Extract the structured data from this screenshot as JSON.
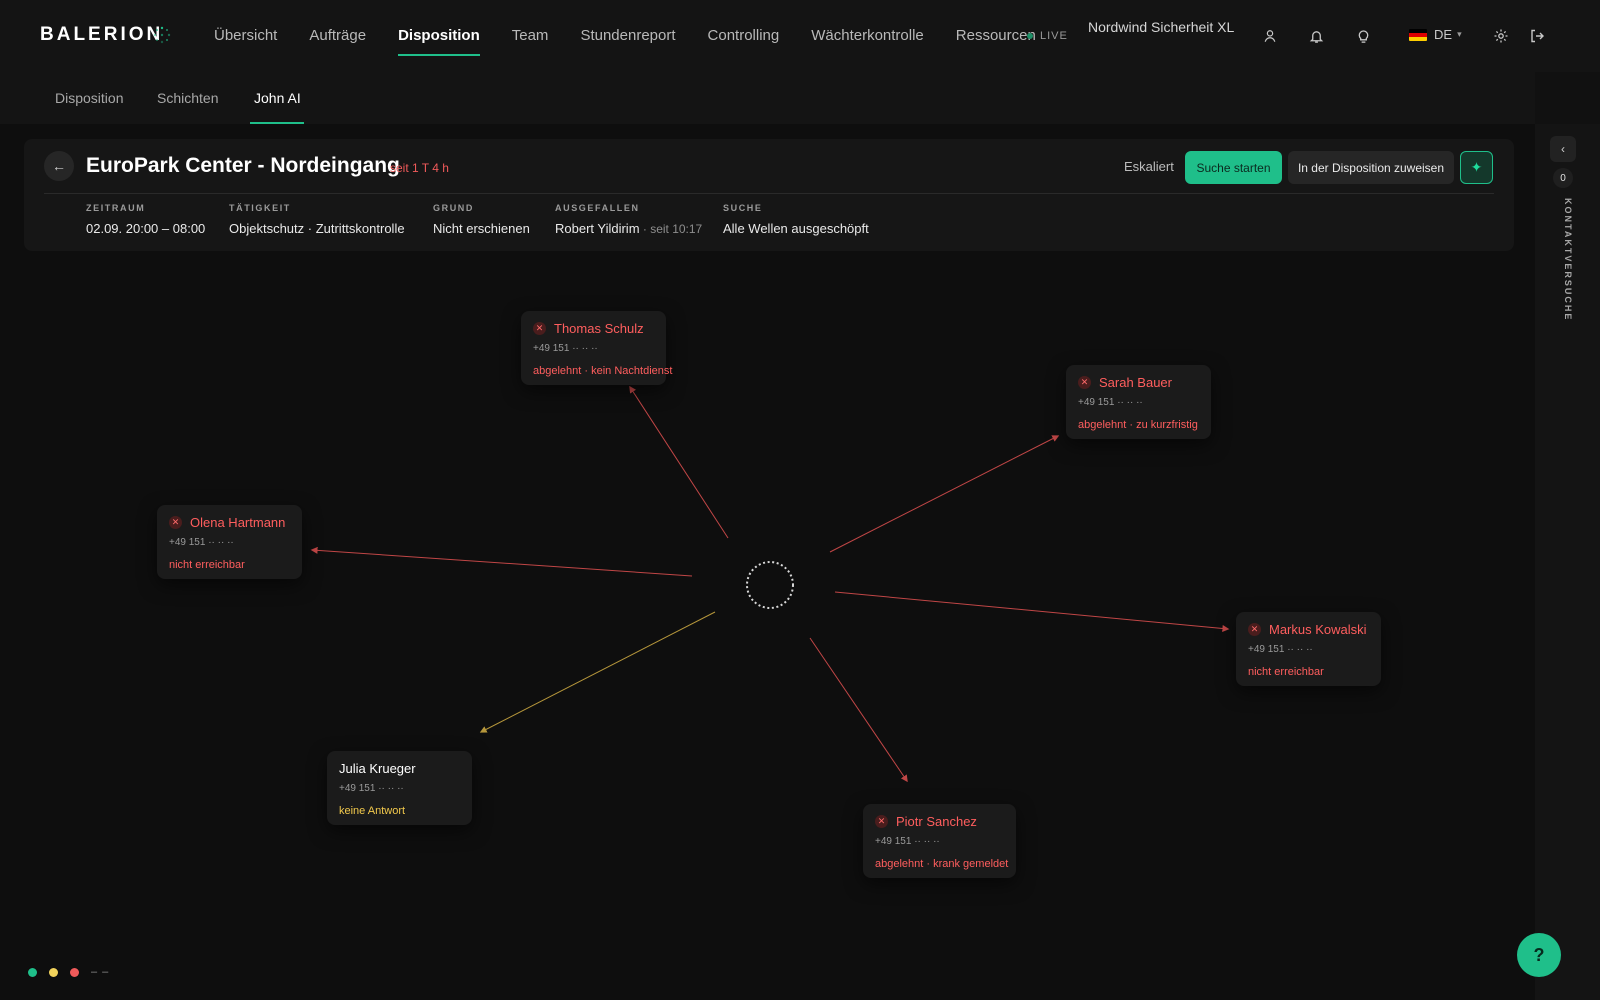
{
  "app": {
    "logo": "BALERION"
  },
  "nav": {
    "items": [
      "Übersicht",
      "Aufträge",
      "Disposition",
      "Team",
      "Stundenreport",
      "Controlling",
      "Wächterkontrolle",
      "Ressourcen"
    ],
    "active": "Disposition",
    "live_label": "LIVE",
    "company": "Nordwind Sicherheit XL",
    "language": "DE"
  },
  "subtabs": {
    "items": [
      "Disposition",
      "Schichten",
      "John AI"
    ],
    "active": "John AI"
  },
  "header": {
    "title": "EuroPark Center - Nordeingang",
    "since": "seit 1 T 4 h",
    "status": "Eskaliert",
    "search_button": "Suche starten",
    "assign_button": "In der Disposition zuweisen",
    "meta": [
      {
        "label": "ZEITRAUM",
        "value": "02.09. 20:00 – 08:00",
        "extra": ""
      },
      {
        "label": "TÄTIGKEIT",
        "value": "Objektschutz · Zutrittskontrolle",
        "extra": ""
      },
      {
        "label": "GRUND",
        "value": "Nicht erschienen",
        "extra": ""
      },
      {
        "label": "AUSGEFALLEN",
        "value": "Robert Yildirim",
        "extra": " · seit 10:17"
      },
      {
        "label": "SUCHE",
        "value": "Alle Wellen ausgeschöpft",
        "extra": ""
      }
    ]
  },
  "contacts": [
    {
      "name": "Thomas Schulz",
      "phone": "+49 151 ·· ·· ··",
      "status": "abgelehnt · kein Nachtdienst",
      "state": "declined"
    },
    {
      "name": "Sarah Bauer",
      "phone": "+49 151 ·· ·· ··",
      "status": "abgelehnt · zu kurzfristig",
      "state": "declined"
    },
    {
      "name": "Olena Hartmann",
      "phone": "+49 151 ·· ·· ··",
      "status": "nicht erreichbar",
      "state": "unreachable"
    },
    {
      "name": "Markus Kowalski",
      "phone": "+49 151 ·· ·· ··",
      "status": "nicht erreichbar",
      "state": "unreachable"
    },
    {
      "name": "Julia Krueger",
      "phone": "+49 151 ·· ·· ··",
      "status": "keine Antwort",
      "state": "no_answer"
    },
    {
      "name": "Piotr Sanchez",
      "phone": "+49 151 ·· ·· ··",
      "status": "abgelehnt · krank gemeldet",
      "state": "declined"
    }
  ],
  "rail": {
    "count": "0",
    "label": "KONTAKTVERSUCHE"
  },
  "help": "?",
  "legend": {
    "text": "– –",
    "colors": [
      "#1fbf8a",
      "#f2d35c",
      "#ef5a5a"
    ]
  },
  "colors": {
    "accent": "#1fbf8a",
    "declined": "#ef5a5a",
    "no_answer": "#c9a640"
  }
}
